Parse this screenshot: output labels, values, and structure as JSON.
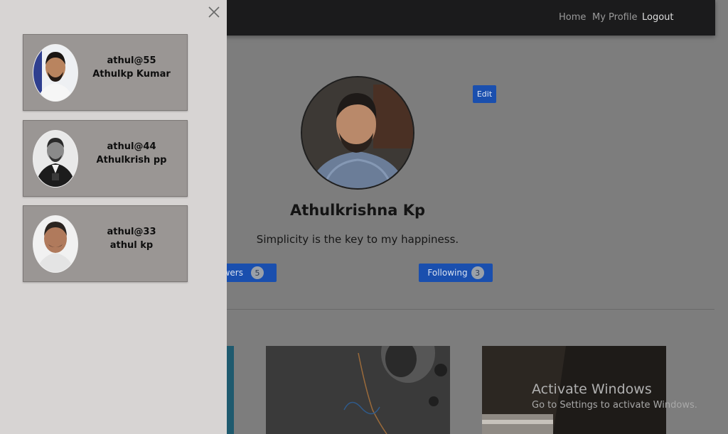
{
  "nav": {
    "home": "Home",
    "my_profile": "My Profile",
    "logout": "Logout"
  },
  "profile": {
    "name": "Athulkrishna Kp",
    "bio": "Simplicity is the key to my happiness.",
    "edit_label": "Edit",
    "followers_label": "owers",
    "followers_count": "5",
    "following_label": "Following",
    "following_count": "3"
  },
  "drawer": {
    "users": [
      {
        "handle": "athul@55",
        "name": "Athulkp Kumar"
      },
      {
        "handle": "athul@44",
        "name": "Athulkrish pp"
      },
      {
        "handle": "athul@33",
        "name": "athul kp"
      }
    ]
  },
  "watermark": {
    "title": "Activate Windows",
    "subtitle": "Go to Settings to activate Windows."
  },
  "colors": {
    "accent": "#1a4fae",
    "navbar": "#1b1b1c",
    "drawer_bg": "#d7d4d3",
    "card_bg": "#9a9694"
  },
  "icons": {
    "close": "close-icon"
  }
}
